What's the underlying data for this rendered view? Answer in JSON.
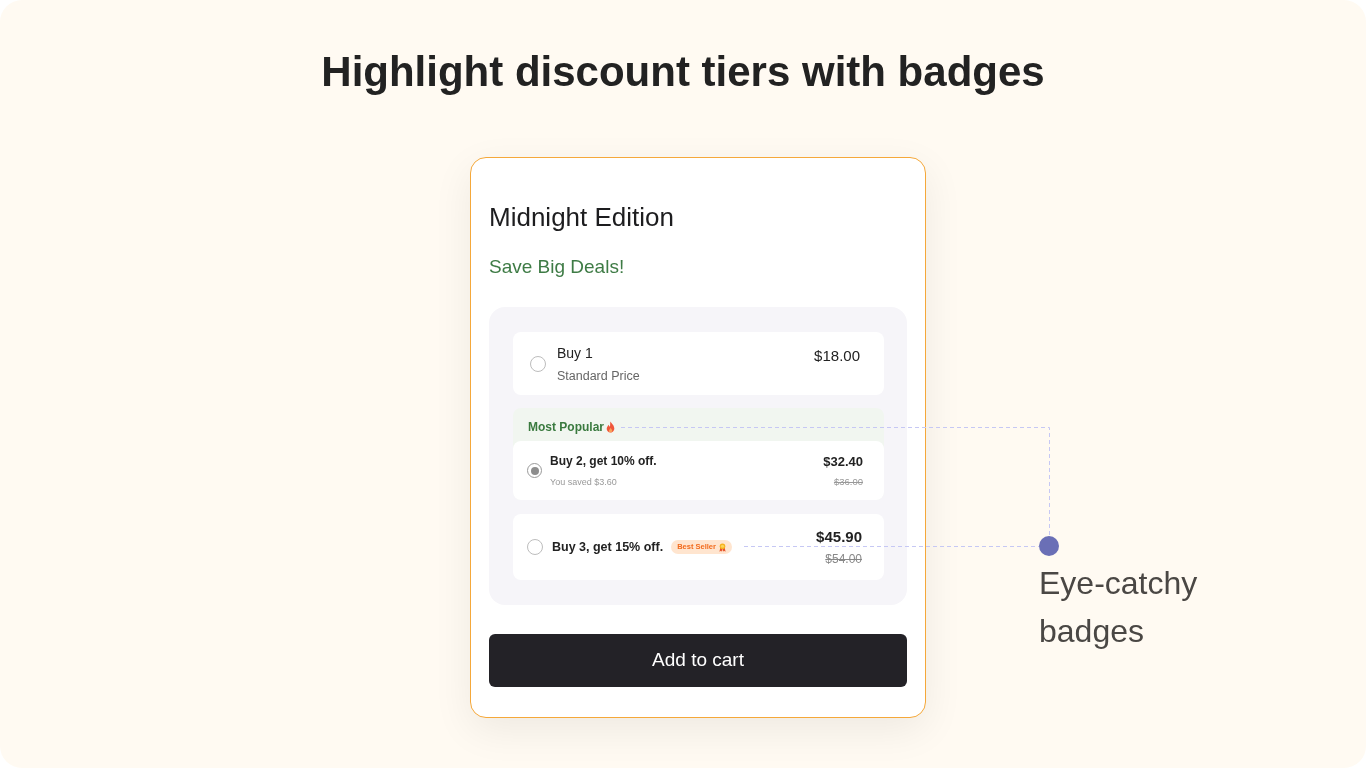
{
  "heading": "Highlight discount tiers with badges",
  "product_card": {
    "title": "Midnight Edition",
    "subtitle": "Save Big Deals!",
    "options": [
      {
        "kind": "plain",
        "label": "Buy 1",
        "note": "Standard Price",
        "price": "$18.00",
        "selected": false
      },
      {
        "kind": "featured",
        "tag": "Most Popular",
        "label": "Buy 2, get 10% off.",
        "note": "You saved $3.60",
        "price": "$32.40",
        "old_price": "$36.00",
        "selected": true
      },
      {
        "kind": "badged",
        "label": "Buy 3, get 15% off.",
        "badge": "Best Seller",
        "price": "$45.90",
        "old_price": "$54.00",
        "selected": false
      }
    ],
    "button": "Add to cart"
  },
  "annotation": {
    "text": "Eye-catchy badges"
  }
}
